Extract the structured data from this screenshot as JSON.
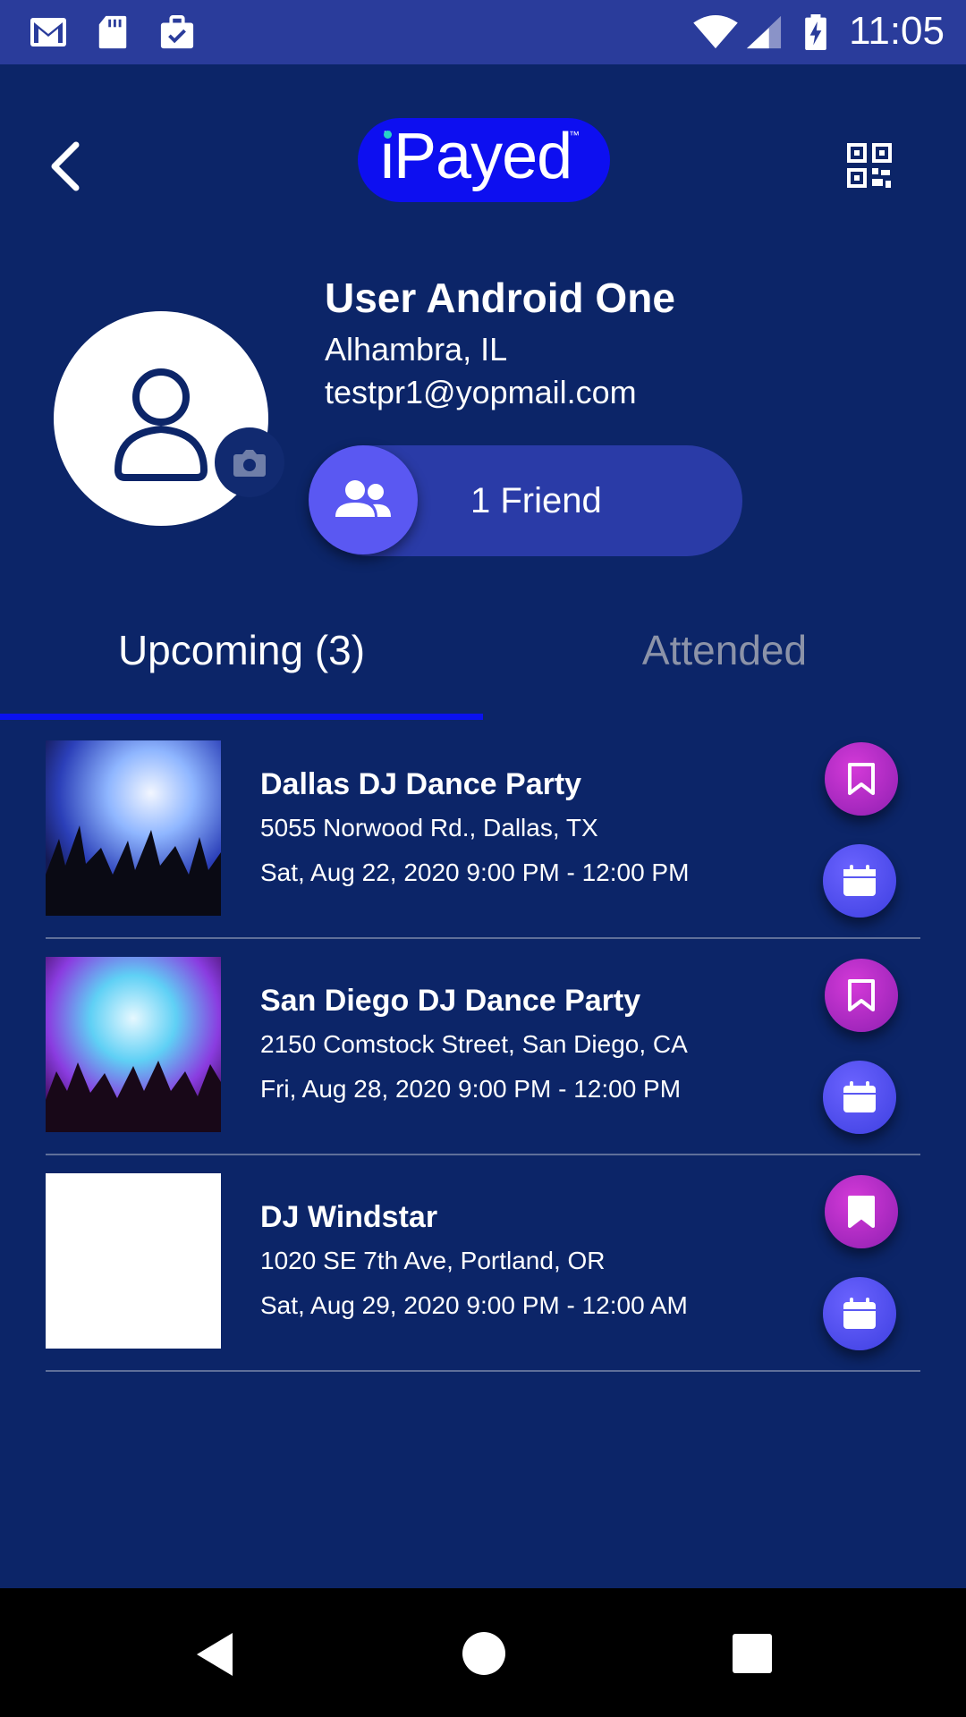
{
  "status_bar": {
    "time": "11:05",
    "icons": [
      "gmail-icon",
      "sd-card-icon",
      "briefcase-check-icon",
      "wifi-icon",
      "signal-icon",
      "battery-charging-icon"
    ]
  },
  "header": {
    "logo": "iPayed",
    "logo_tm": "™",
    "back_icon": "chevron-left-icon",
    "qr_icon": "qr-code-icon"
  },
  "profile": {
    "name": "User Android One",
    "location": "Alhambra, IL",
    "email": "testpr1@yopmail.com",
    "friends_label": "1 Friend"
  },
  "tabs": [
    {
      "label": "Upcoming (3)",
      "active": true
    },
    {
      "label": "Attended",
      "active": false
    }
  ],
  "events": [
    {
      "title": "Dallas DJ Dance Party",
      "address": "5055 Norwood Rd., Dallas, TX",
      "datetime": "Sat, Aug 22, 2020 9:00 PM - 12:00 PM",
      "bookmarked": false
    },
    {
      "title": "San Diego DJ Dance Party",
      "address": "2150 Comstock Street, San Diego, CA",
      "datetime": "Fri, Aug 28, 2020 9:00 PM - 12:00 PM",
      "bookmarked": false
    },
    {
      "title": "DJ Windstar",
      "address": "1020 SE 7th Ave, Portland, OR",
      "datetime": "Sat, Aug 29, 2020 9:00 PM - 12:00 AM",
      "bookmarked": true
    }
  ],
  "colors": {
    "background": "#0c2568",
    "accent": "#0a12ef",
    "bookmark": "#c231cf",
    "calendar": "#5a58f2"
  }
}
